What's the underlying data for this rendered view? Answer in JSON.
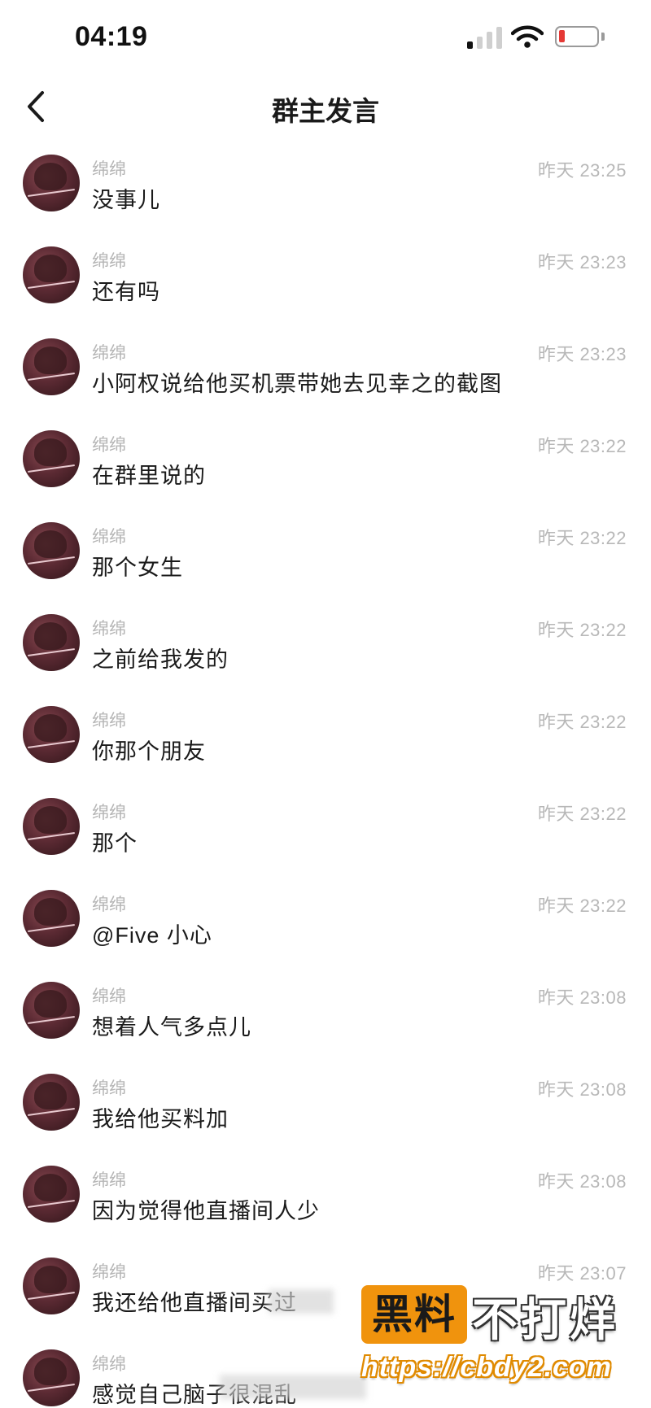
{
  "status_bar": {
    "time": "04:19",
    "battery_level": 0.15
  },
  "nav": {
    "title": "群主发言"
  },
  "messages": [
    {
      "sender": "绵绵",
      "time": "昨天 23:25",
      "text": "没事儿"
    },
    {
      "sender": "绵绵",
      "time": "昨天 23:23",
      "text": "还有吗"
    },
    {
      "sender": "绵绵",
      "time": "昨天 23:23",
      "text": "小阿权说给他买机票带她去见幸之的截图"
    },
    {
      "sender": "绵绵",
      "time": "昨天 23:22",
      "text": "在群里说的"
    },
    {
      "sender": "绵绵",
      "time": "昨天 23:22",
      "text": "那个女生"
    },
    {
      "sender": "绵绵",
      "time": "昨天 23:22",
      "text": "之前给我发的"
    },
    {
      "sender": "绵绵",
      "time": "昨天 23:22",
      "text": "你那个朋友"
    },
    {
      "sender": "绵绵",
      "time": "昨天 23:22",
      "text": "那个"
    },
    {
      "sender": "绵绵",
      "time": "昨天 23:22",
      "text": "@Five 小心"
    },
    {
      "sender": "绵绵",
      "time": "昨天 23:08",
      "text": "想着人气多点儿"
    },
    {
      "sender": "绵绵",
      "time": "昨天 23:08",
      "text": "我给他买料加"
    },
    {
      "sender": "绵绵",
      "time": "昨天 23:08",
      "text": "因为觉得他直播间人少"
    },
    {
      "sender": "绵绵",
      "time": "昨天 23:07",
      "text": "我还给他直播间买过"
    },
    {
      "sender": "绵绵",
      "time": "",
      "text": "感觉自己脑子很混乱"
    }
  ],
  "watermark": {
    "badge": "黑料",
    "title": "不打烊",
    "url": "https://cbdy2.com"
  },
  "colors": {
    "accent": "#f0930d",
    "meta_gray": "#b8b8b8",
    "battery_low": "#e53935"
  }
}
